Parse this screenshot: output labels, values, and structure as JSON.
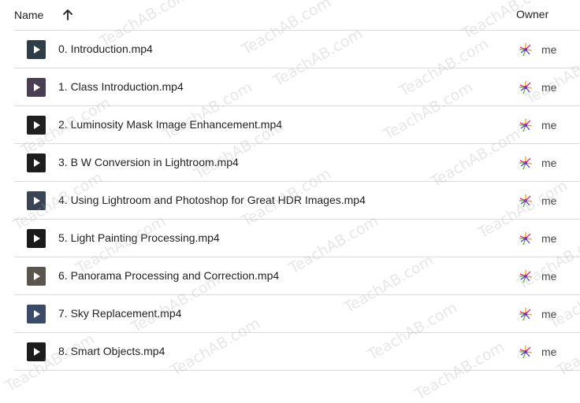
{
  "header": {
    "name_label": "Name",
    "owner_label": "Owner",
    "sort_icon": "arrow-upward-icon"
  },
  "files": [
    {
      "name": "0. Introduction.mp4",
      "owner": "me",
      "thumb_color": "#2f3e46"
    },
    {
      "name": "1. Class Introduction.mp4",
      "owner": "me",
      "thumb_color": "#4a3f52"
    },
    {
      "name": "2. Luminosity Mask Image Enhancement.mp4",
      "owner": "me",
      "thumb_color": "#202020"
    },
    {
      "name": "3. B W Conversion in Lightroom.mp4",
      "owner": "me",
      "thumb_color": "#1e1e1e"
    },
    {
      "name": "4. Using Lightroom and Photoshop for Great HDR Images.mp4",
      "owner": "me",
      "thumb_color": "#3a4452"
    },
    {
      "name": "5. Light Painting Processing.mp4",
      "owner": "me",
      "thumb_color": "#1a1a1a"
    },
    {
      "name": "6. Panorama Processing and Correction.mp4",
      "owner": "me",
      "thumb_color": "#5b5550"
    },
    {
      "name": "7. Sky Replacement.mp4",
      "owner": "me",
      "thumb_color": "#3b4a66"
    },
    {
      "name": "8. Smart Objects.mp4",
      "owner": "me",
      "thumb_color": "#1c1c1c"
    }
  ],
  "watermark_text": "TeachAB.com"
}
